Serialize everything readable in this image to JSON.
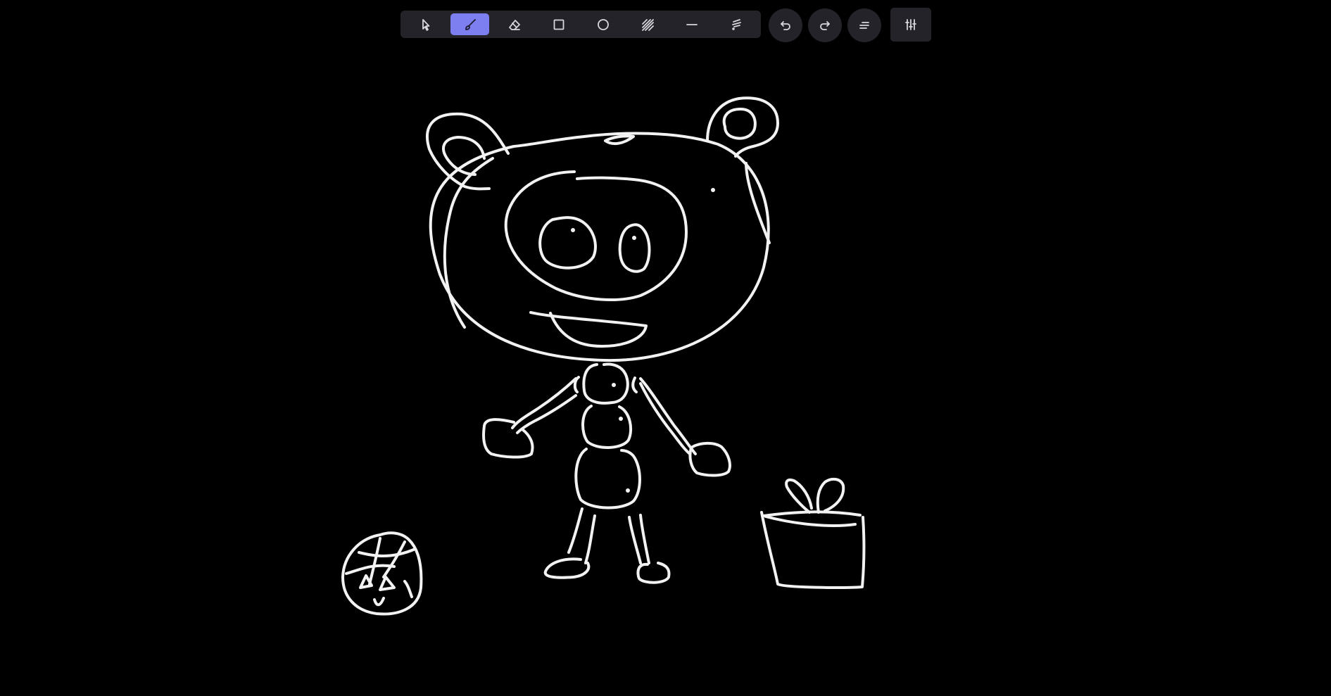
{
  "app": {
    "canvas_background": "#000000",
    "stroke_color": "#f2f2f2",
    "accent_color": "#7d7ff0",
    "toolbar_background": "#232329"
  },
  "toolbar": {
    "tools": [
      {
        "id": "select",
        "icon": "cursor-icon",
        "active": false
      },
      {
        "id": "brush",
        "icon": "brush-icon",
        "active": true
      },
      {
        "id": "eraser",
        "icon": "eraser-icon",
        "active": false
      },
      {
        "id": "rectangle",
        "icon": "square-icon",
        "active": false
      },
      {
        "id": "ellipse",
        "icon": "circle-icon",
        "active": false
      },
      {
        "id": "hatch",
        "icon": "hatch-icon",
        "active": false
      },
      {
        "id": "line",
        "icon": "line-icon",
        "active": false
      },
      {
        "id": "laser",
        "icon": "laser-icon",
        "active": false
      }
    ]
  },
  "actions": [
    {
      "id": "undo",
      "icon": "undo-icon"
    },
    {
      "id": "redo",
      "icon": "redo-icon"
    },
    {
      "id": "menu",
      "icon": "lines-icon"
    },
    {
      "id": "settings",
      "icon": "sliders-icon"
    }
  ],
  "drawing": {
    "subjects": [
      "bear-character",
      "ball",
      "gift-box"
    ]
  }
}
